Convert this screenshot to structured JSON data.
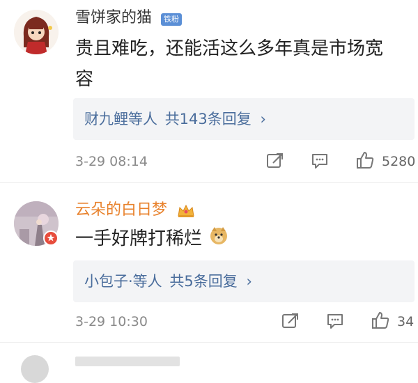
{
  "comments": [
    {
      "username": "雪饼家的猫",
      "badge": "铁粉",
      "text_line1": "贵且难吃，还能活这么多年真是市场宽",
      "text_line2": "容",
      "reply_summary_names": "财九鲤等人",
      "reply_summary_count": "共143条回复",
      "time": "3-29 08:14",
      "likes": "5280"
    },
    {
      "username": "云朵的白日梦",
      "text_line1": "一手好牌打稀烂",
      "reply_summary_names": "小包子·等人",
      "reply_summary_count": "共5条回复",
      "time": "3-29 10:30",
      "likes": "34"
    }
  ],
  "colors": {
    "username_orange": "#e8812b",
    "link_blue": "#4a6d9c",
    "badge_blue": "#5b8fd6"
  }
}
